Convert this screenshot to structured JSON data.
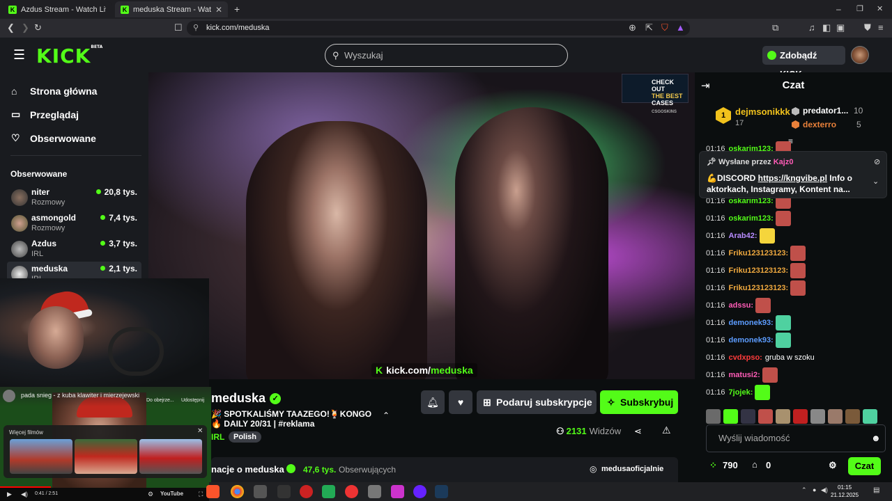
{
  "browser": {
    "tabs": [
      {
        "title": "Azdus Stream - Watch Live on Kick",
        "active": false
      },
      {
        "title": "meduska Stream - Watch Live on Kick",
        "active": true
      }
    ],
    "new_tab": "+",
    "url": "kick.com/meduska",
    "window_controls": [
      "–",
      "❐",
      "✕"
    ]
  },
  "header": {
    "logo": "KICK",
    "logo_badge": "BETA",
    "search_placeholder": "Wyszukaj",
    "kicks_button": "Zdobądź KICKs"
  },
  "sidebar": {
    "nav": [
      {
        "label": "Strona główna",
        "icon": "home-icon"
      },
      {
        "label": "Przeglądaj",
        "icon": "browse-icon"
      },
      {
        "label": "Obserwowane",
        "icon": "heart-icon"
      }
    ],
    "following_heading": "Obserwowane",
    "following": [
      {
        "name": "niter",
        "category": "Rozmowy",
        "viewers": "20,8 tys."
      },
      {
        "name": "asmongold",
        "category": "Rozmowy",
        "viewers": "7,4 tys."
      },
      {
        "name": "Azdus",
        "category": "IRL",
        "viewers": "3,7 tys."
      },
      {
        "name": "meduska",
        "category": "IRL",
        "viewers": "2,1 tys."
      }
    ]
  },
  "video": {
    "watermark_domain": "kick.com/",
    "watermark_name": "meduska",
    "ad_lines": [
      "CHECK OUT",
      "THE BEST",
      "CASES"
    ],
    "ad_brand": "CSGOSKINS"
  },
  "youtube_overlay": {
    "video_title": "pada snieg - z kuba klawiter i mierzejewski",
    "later_label": "Do obejrze...",
    "share_label": "Udostępnij",
    "more_videos": "Więcej filmów",
    "time": "0:41 / 2:51",
    "brand": "YouTube",
    "progress": 0.24
  },
  "stream": {
    "streamer": "meduska",
    "title": "🎉 SPOTKALIŚMY TAAZEGO!🍹KONGO🔥 DAILY 20/31 | #reklama",
    "category": "IRL",
    "tag": "Polish",
    "gift_button": "Podaruj subskrypcje",
    "subscribe_button": "Subskrybuj",
    "viewers_count": "2131",
    "viewers_label": "Widzów",
    "about_title": "nacje o meduska",
    "followers_count": "47,6 tys.",
    "followers_label": "Obserwujących",
    "instagram": "medusaoficjalnie"
  },
  "chat": {
    "title": "Czat",
    "top_gifters": [
      {
        "rank": "1",
        "name": "dejmsonikkk",
        "count": "17"
      },
      {
        "rank": "2",
        "name": "predator1...",
        "count": "10"
      },
      {
        "rank": "3",
        "name": "dexterro",
        "count": "5"
      }
    ],
    "pinned_by_label": "Wysłane przez",
    "pinned_by_user": "Kajz0",
    "pinned_message_prefix": "💪DISCORD ",
    "pinned_link": "https://kngvibe.pl",
    "pinned_message_suffix": " Info o aktorkach, Instagramy, Kontent na...",
    "messages": [
      {
        "time": "01:16",
        "user": "oskarim123:",
        "text": "",
        "color": "#53fc18",
        "emote": "#c0504a"
      },
      {
        "time": "01:16",
        "user": "oskarim123:",
        "text": "",
        "color": "#53fc18",
        "emote": "#c0504a"
      },
      {
        "time": "01:16",
        "user": "oskarim123:",
        "text": "",
        "color": "#53fc18",
        "emote": "#c0504a"
      },
      {
        "time": "01:16",
        "user": "Arab42:",
        "text": "",
        "color": "#b88cff",
        "emote": "#f5d53c"
      },
      {
        "time": "01:16",
        "user": "Friku123123123:",
        "text": "",
        "color": "#f0a93f",
        "emote": "#c0504a"
      },
      {
        "time": "01:16",
        "user": "Friku123123123:",
        "text": "",
        "color": "#f0a93f",
        "emote": "#c0504a"
      },
      {
        "time": "01:16",
        "user": "Friku123123123:",
        "text": "",
        "color": "#f0a93f",
        "emote": "#c0504a"
      },
      {
        "time": "01:16",
        "user": "adssu:",
        "text": "",
        "color": "#ff5cb7",
        "emote": "#c0504a"
      },
      {
        "time": "01:16",
        "user": "demonek93:",
        "text": "",
        "color": "#5c9cff",
        "emote": "#4fd1a0"
      },
      {
        "time": "01:16",
        "user": "demonek93:",
        "text": "",
        "color": "#5c9cff",
        "emote": "#4fd1a0"
      },
      {
        "time": "01:16",
        "user": "cvdxpso:",
        "text": "gruba w szoku",
        "color": "#ff3b3b",
        "emote": ""
      },
      {
        "time": "01:16",
        "user": "matusi2:",
        "text": "",
        "color": "#ff5cb7",
        "emote": "#c0504a"
      },
      {
        "time": "01:16",
        "user": "7jojek:",
        "text": "",
        "color": "#53fc18",
        "emote": "#53fc18"
      }
    ],
    "input_placeholder": "Wyślij wiadomość",
    "points": "790",
    "subs": "0",
    "send_button": "Czat"
  },
  "taskbar": {
    "time": "01:15",
    "date": "21.12.2025"
  },
  "colors": {
    "accent": "#53fc18",
    "background": "#0b0e0f",
    "panel": "#191b1f"
  }
}
